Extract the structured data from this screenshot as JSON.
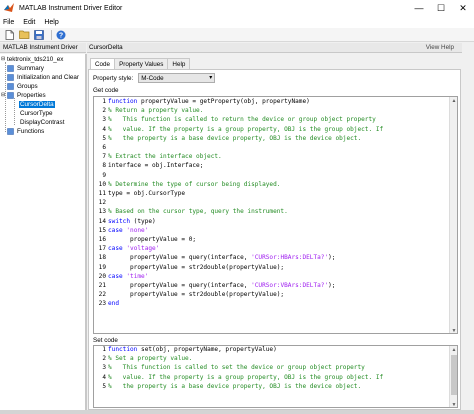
{
  "window": {
    "title": "MATLAB Instrument Driver Editor",
    "controls": {
      "minimize": "—",
      "maximize": "☐",
      "close": "✕"
    }
  },
  "menu": [
    "File",
    "Edit",
    "Help"
  ],
  "toolbar": {
    "icons": [
      "new-file-icon",
      "open-folder-icon",
      "save-icon",
      "help-icon"
    ]
  },
  "tree": {
    "header": "MATLAB Instrument Driver",
    "root": "tektronix_tds210_ex",
    "items": [
      {
        "label": "Summary",
        "icon": "summary-icon"
      },
      {
        "label": "Initialization and Clear",
        "icon": "init-icon"
      },
      {
        "label": "Groups",
        "icon": "groups-icon"
      },
      {
        "label": "Properties",
        "icon": "properties-icon"
      }
    ],
    "properties": [
      "CursorDelta",
      "CursorType",
      "DisplayContrast"
    ],
    "selected": "CursorDelta",
    "functions": "Functions"
  },
  "main": {
    "header": "CursorDelta",
    "help_link": "View Help",
    "tabs": [
      {
        "label": "Code",
        "active": true
      },
      {
        "label": "Property Values",
        "active": false
      },
      {
        "label": "Help",
        "active": false
      }
    ],
    "property_style_label": "Property style:",
    "property_style_value": "M-Code",
    "get_code_label": "Get code",
    "set_code_label": "Set code"
  },
  "get_code": [
    {
      "n": "1",
      "parts": [
        [
          "kw",
          "function"
        ],
        [
          "pl",
          " propertyValue = getProperty(obj, propertyName)"
        ]
      ]
    },
    {
      "n": "2",
      "parts": [
        [
          "cm",
          "% Return a property value."
        ]
      ]
    },
    {
      "n": "3",
      "parts": [
        [
          "cm",
          "%   This function is called to return the device or group object property"
        ]
      ]
    },
    {
      "n": "4",
      "parts": [
        [
          "cm",
          "%   value. If the property is a group property, OBJ is the group object. If"
        ]
      ]
    },
    {
      "n": "5",
      "parts": [
        [
          "cm",
          "%   the property is a base device property, OBJ is the device object."
        ]
      ]
    },
    {
      "n": "6",
      "parts": []
    },
    {
      "n": "7",
      "parts": [
        [
          "cm",
          "% Extract the interface object."
        ]
      ]
    },
    {
      "n": "8",
      "parts": [
        [
          "pl",
          "interface = obj.Interface;"
        ]
      ]
    },
    {
      "n": "9",
      "parts": []
    },
    {
      "n": "10",
      "parts": [
        [
          "cm",
          "% Determine the type of cursor being displayed."
        ]
      ]
    },
    {
      "n": "11",
      "parts": [
        [
          "pl",
          "type = obj.CursorType"
        ]
      ]
    },
    {
      "n": "12",
      "parts": []
    },
    {
      "n": "13",
      "parts": [
        [
          "cm",
          "% Based on the cursor type, query the instrument."
        ]
      ]
    },
    {
      "n": "14",
      "parts": [
        [
          "kw",
          "switch"
        ],
        [
          "pl",
          " (type)"
        ]
      ]
    },
    {
      "n": "15",
      "parts": [
        [
          "kw",
          "case"
        ],
        [
          "pl",
          " "
        ],
        [
          "st",
          "'none'"
        ]
      ]
    },
    {
      "n": "16",
      "parts": [
        [
          "pl",
          "      propertyValue = 0;"
        ]
      ]
    },
    {
      "n": "17",
      "parts": [
        [
          "kw",
          "case"
        ],
        [
          "pl",
          " "
        ],
        [
          "st",
          "'voltage'"
        ]
      ]
    },
    {
      "n": "18",
      "parts": [
        [
          "pl",
          "      propertyValue = query(interface, "
        ],
        [
          "st",
          "'CURSor:HBArs:DELTa?'"
        ],
        [
          "pl",
          ");"
        ]
      ]
    },
    {
      "n": "19",
      "parts": [
        [
          "pl",
          "      propertyValue = str2double(propertyValue);"
        ]
      ]
    },
    {
      "n": "20",
      "parts": [
        [
          "kw",
          "case"
        ],
        [
          "pl",
          " "
        ],
        [
          "st",
          "'time'"
        ]
      ]
    },
    {
      "n": "21",
      "parts": [
        [
          "pl",
          "      propertyValue = query(interface, "
        ],
        [
          "st",
          "'CURSor:VBArs:DELTa?'"
        ],
        [
          "pl",
          ");"
        ]
      ]
    },
    {
      "n": "22",
      "parts": [
        [
          "pl",
          "      propertyValue = str2double(propertyValue);"
        ]
      ]
    },
    {
      "n": "23",
      "parts": [
        [
          "kw",
          "end"
        ]
      ]
    }
  ],
  "set_code": [
    {
      "n": "1",
      "parts": [
        [
          "kw",
          "function"
        ],
        [
          "pl",
          " set(obj, propertyName, propertyValue)"
        ]
      ]
    },
    {
      "n": "2",
      "parts": [
        [
          "cm",
          "% Set a property value."
        ]
      ]
    },
    {
      "n": "3",
      "parts": [
        [
          "cm",
          "%   This function is called to set the device or group object property"
        ]
      ]
    },
    {
      "n": "4",
      "parts": [
        [
          "cm",
          "%   value. If the property is a group property, OBJ is the group object. If"
        ]
      ]
    },
    {
      "n": "5",
      "parts": [
        [
          "cm",
          "%   the property is a base device property, OBJ is the device object."
        ]
      ]
    }
  ],
  "colors": {
    "keyword": "#0000ff",
    "comment": "#228b22",
    "string": "#a020f0",
    "selection": "#0078d7"
  }
}
